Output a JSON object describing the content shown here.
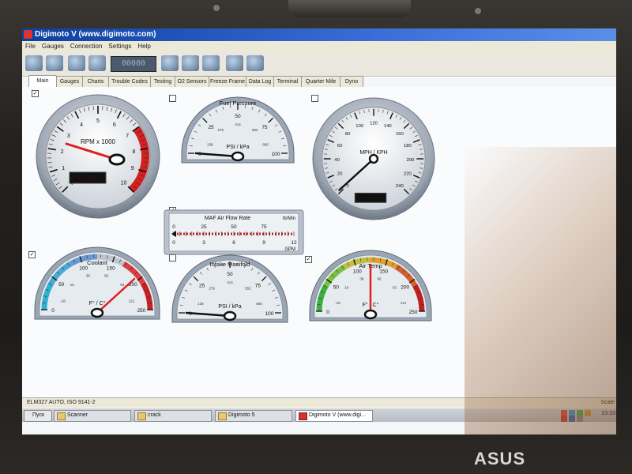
{
  "window": {
    "title": "Digimoto V (www.digimoto.com)"
  },
  "menu": [
    "File",
    "Gauges",
    "Connection",
    "Settings",
    "Help"
  ],
  "toolbar": {
    "display": "00000"
  },
  "tabs": [
    {
      "label": "Main",
      "active": true
    },
    {
      "label": "Gauges",
      "active": false
    },
    {
      "label": "Charts",
      "active": false
    },
    {
      "label": "Trouble Codes",
      "active": false
    },
    {
      "label": "Testing",
      "active": false
    },
    {
      "label": "O2 Sensors",
      "active": false
    },
    {
      "label": "Freeze Frame",
      "active": false
    },
    {
      "label": "Data Log",
      "active": false
    },
    {
      "label": "Terminal",
      "active": false
    },
    {
      "label": "Quarter Mile",
      "active": false
    },
    {
      "label": "Dyno",
      "active": false
    }
  ],
  "gauges": {
    "rpm": {
      "label": "RPM x 1000",
      "ticks": [
        "0",
        "1",
        "2",
        "3",
        "4",
        "5",
        "6",
        "7",
        "8",
        "9",
        "10"
      ],
      "digital": "0.00",
      "checked": true
    },
    "fuel": {
      "label": "Fuel Pressure",
      "unit": "PSI / kPa",
      "ticks": [
        "0",
        "25",
        "50",
        "75",
        "100"
      ],
      "inner_ticks": [
        "138",
        "276",
        "414",
        "552",
        "690"
      ],
      "checked": false
    },
    "speed": {
      "label": "MPH / KPH",
      "ticks": [
        "0",
        "20",
        "40",
        "60",
        "80",
        "100",
        "120",
        "140",
        "160",
        "180",
        "200",
        "220",
        "240"
      ],
      "checked": false
    },
    "maf": {
      "label": "MAF Air Flow Rate",
      "unit_top": "lb/Min",
      "unit_bottom": "GPM",
      "top_ticks": [
        "0",
        "25",
        "50",
        "75"
      ],
      "bottom_ticks": [
        "0",
        "3",
        "6",
        "9",
        "12"
      ],
      "checked": true
    },
    "coolant": {
      "label": "Coolant",
      "unit": "F° / C°",
      "ticks": [
        "0",
        "50",
        "100",
        "150",
        "200",
        "250"
      ],
      "inner_ticks": [
        "-18",
        "10",
        "38",
        "66",
        "93",
        "121"
      ],
      "checked": true
    },
    "intake": {
      "label": "Intake Manifold",
      "unit": "PSI / kPa",
      "ticks": [
        "0",
        "25",
        "50",
        "75",
        "100"
      ],
      "inner_ticks": [
        "138",
        "276",
        "414",
        "552",
        "690"
      ],
      "checked": false
    },
    "air": {
      "label": "Air Temp",
      "unit": "F° / C°",
      "ticks": [
        "0",
        "50",
        "100",
        "150",
        "200",
        "250"
      ],
      "inner_ticks": [
        "-18",
        "10",
        "38",
        "66",
        "93",
        "121"
      ],
      "checked": true
    }
  },
  "status": {
    "text": "ELM327 AUTO, ISO 9141-2",
    "right": "Scale"
  },
  "taskbar": {
    "start": "Пуск",
    "tasks": [
      {
        "label": "Scanner"
      },
      {
        "label": "crack"
      },
      {
        "label": "Digimoto 5"
      },
      {
        "label": "Digimoto V (www.digi..."
      }
    ],
    "time": "23:33"
  },
  "laptop": {
    "brand": "ASUS"
  }
}
